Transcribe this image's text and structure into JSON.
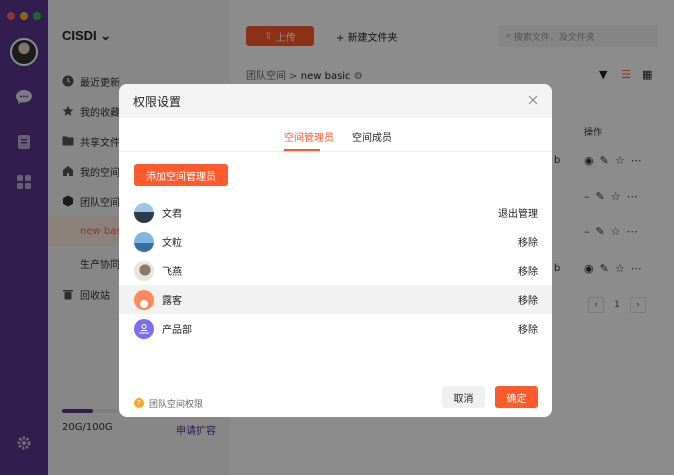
{
  "colors": {
    "accent": "#ff5a2c",
    "brand": "#5b3690",
    "window_dots": [
      "#ff5f57",
      "#febc2e",
      "#28c840"
    ]
  },
  "sidebar": {
    "org_name": "CISDI",
    "items": [
      {
        "label": "最近更新",
        "icon": "clock-icon"
      },
      {
        "label": "我的收藏",
        "icon": "star-icon"
      },
      {
        "label": "共享文件",
        "icon": "folder-shared-icon"
      },
      {
        "label": "我的空间",
        "icon": "home-icon"
      },
      {
        "label": "团队空间",
        "icon": "cube-icon"
      },
      {
        "label": "new basic",
        "icon": ""
      },
      {
        "label": "生产协同",
        "icon": ""
      },
      {
        "label": "回收站",
        "icon": "trash-icon"
      }
    ],
    "storage": {
      "text": "20G/100G",
      "link": "申请扩容",
      "used_fraction": 0.2
    }
  },
  "toolbar": {
    "upload_label": "上传",
    "new_folder_label": "新建文件夹",
    "search_placeholder": "搜索文件、及文件夹"
  },
  "breadcrumb": {
    "root": "团队空间",
    "current": "new basic"
  },
  "table": {
    "ops_header": "操作",
    "pager_page": "1"
  },
  "modal": {
    "title": "权限设置",
    "tabs": [
      "空间管理员",
      "空间成员"
    ],
    "add_button": "添加空间管理员",
    "members": [
      {
        "name": "文君",
        "action": "退出管理"
      },
      {
        "name": "文粒",
        "action": "移除"
      },
      {
        "name": "飞燕",
        "action": "移除"
      },
      {
        "name": "露客",
        "action": "移除"
      },
      {
        "name": "产品部",
        "action": "移除"
      }
    ],
    "footer_hint": "团队空间权限",
    "cancel": "取消",
    "confirm": "确定"
  }
}
